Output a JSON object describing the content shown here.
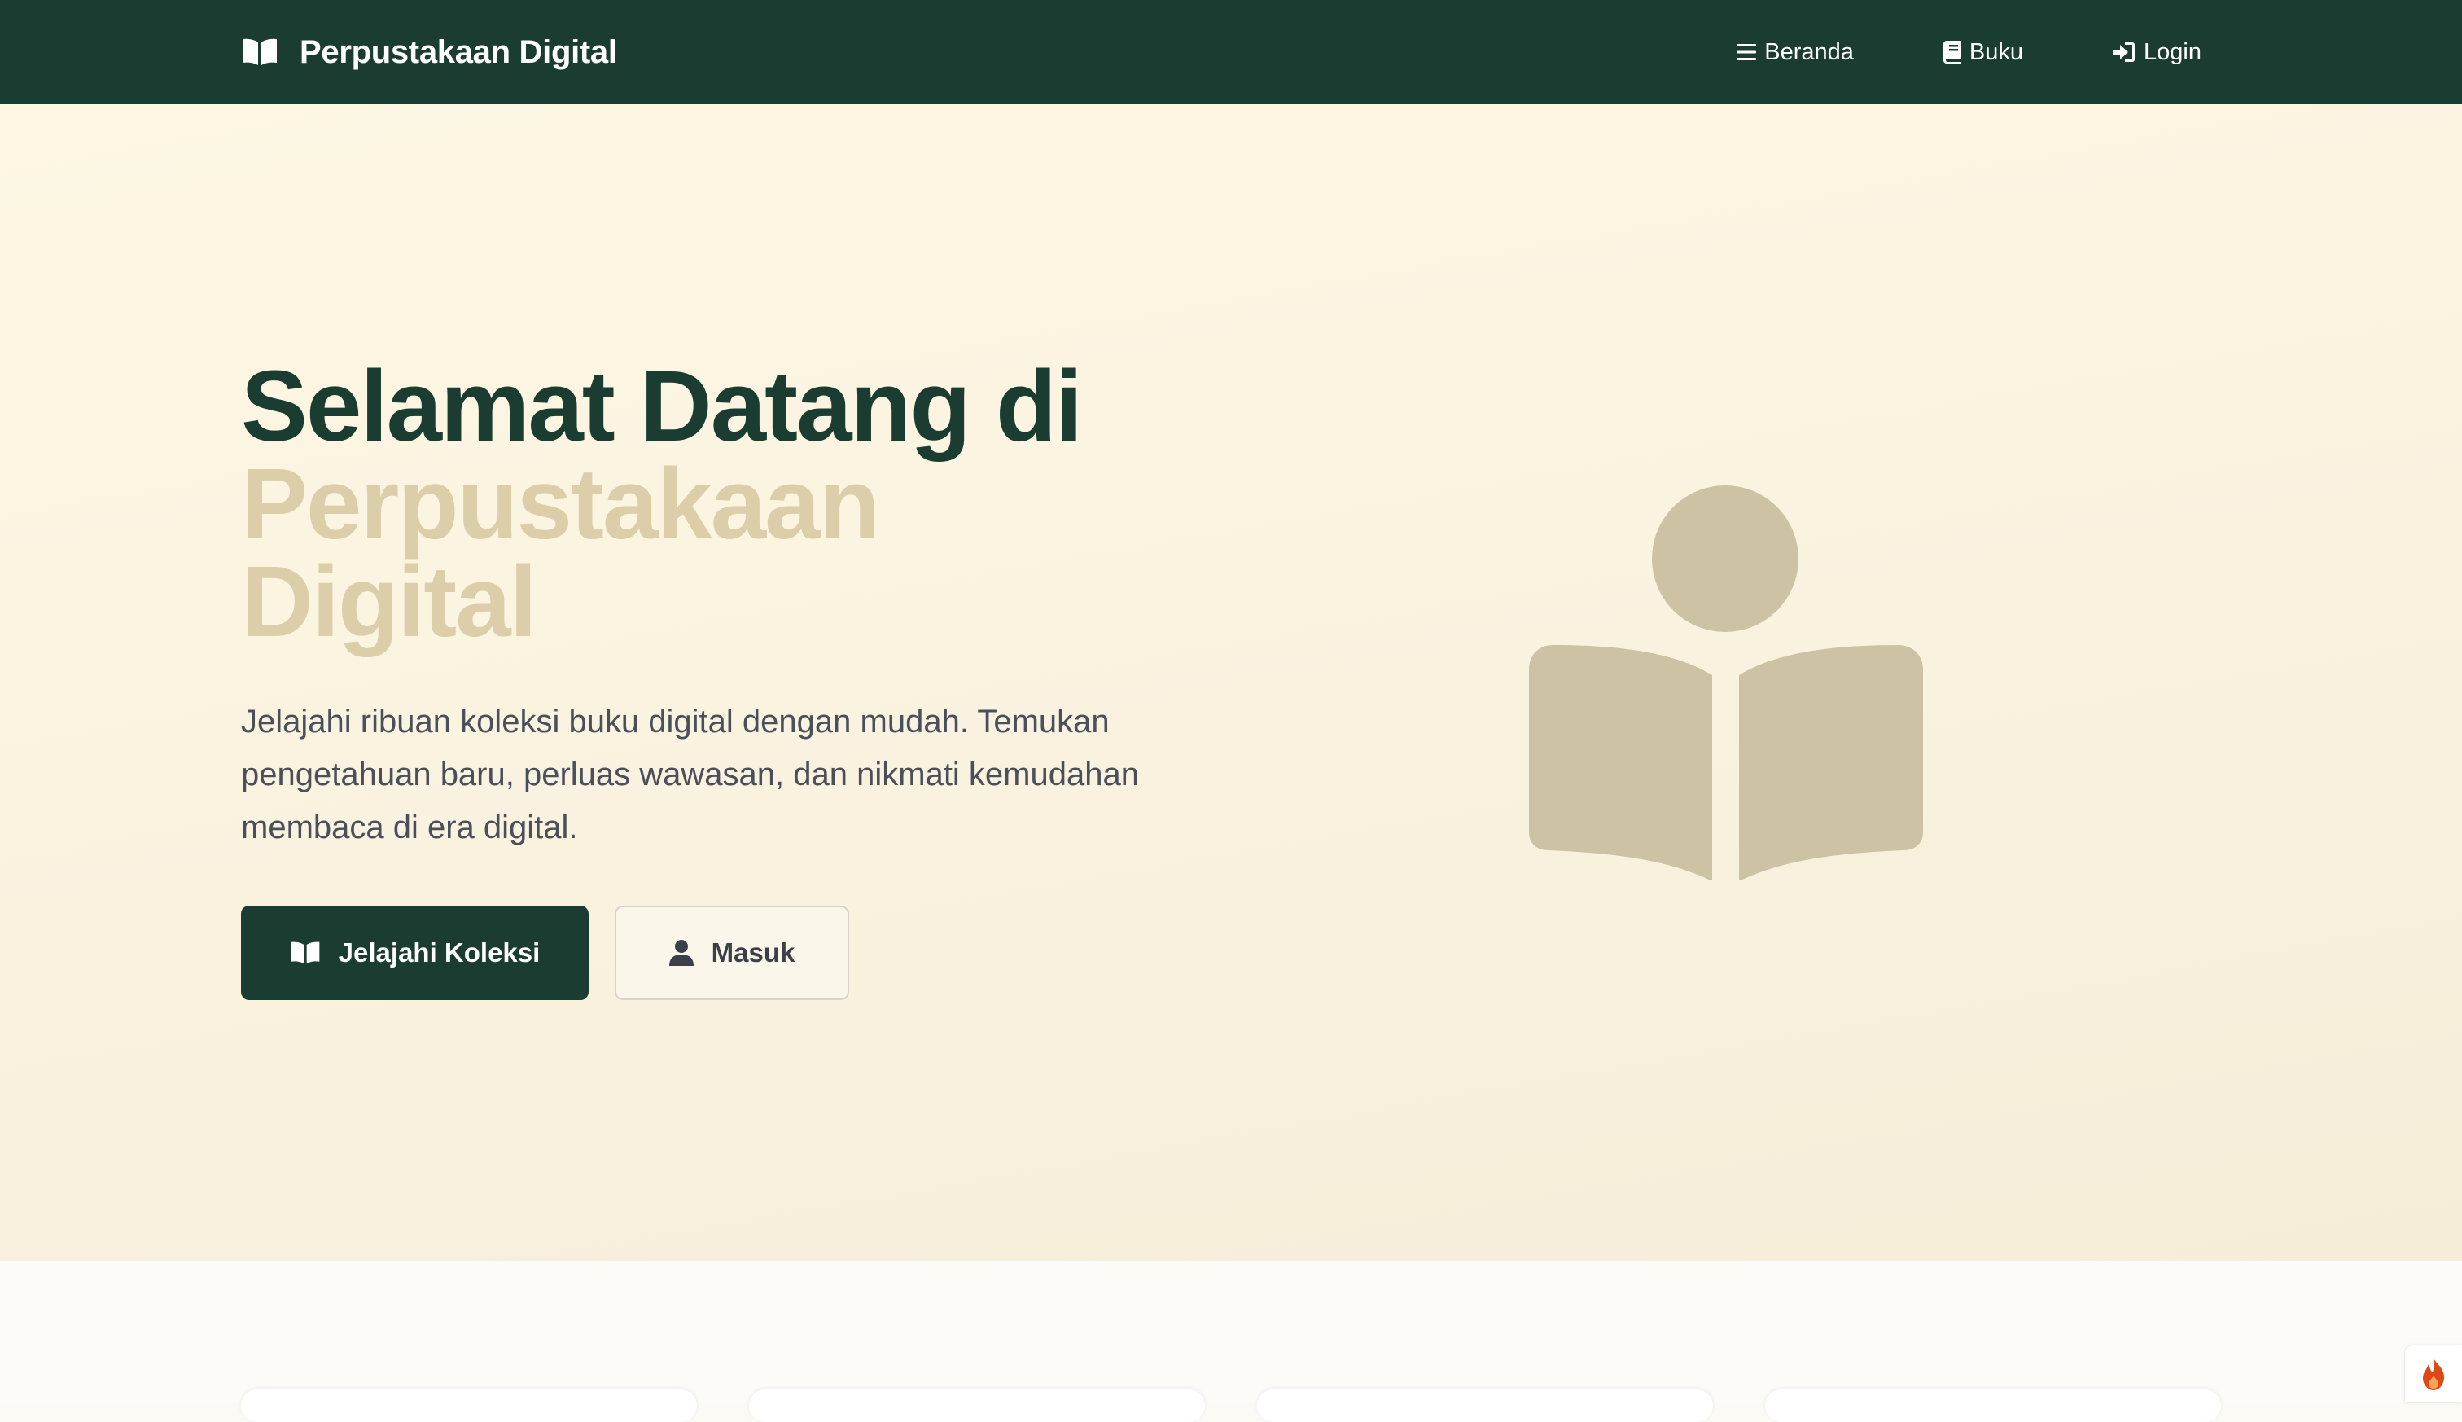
{
  "navbar": {
    "brand": "Perpustakaan Digital",
    "links": [
      {
        "label": "Beranda",
        "icon": "menu-icon"
      },
      {
        "label": "Buku",
        "icon": "book-icon"
      },
      {
        "label": "Login",
        "icon": "login-icon"
      }
    ]
  },
  "hero": {
    "title_line1": "Selamat Datang di",
    "title_accent": "Perpustakaan Digital",
    "description": "Jelajahi ribuan koleksi buku digital dengan mudah. Temukan pengetahuan baru, perluas wawasan, dan nikmati kemudahan membaca di era digital.",
    "primary_button": "Jelajahi Koleksi",
    "secondary_button": "Masuk",
    "illustration_icon": "book-reader-icon"
  },
  "colors": {
    "navbar_bg": "#1b3d31",
    "primary": "#1b3d31",
    "accent_text": "#dbcea9",
    "illustration": "#cdc3a4",
    "hero_bg": "#fdf7e4"
  },
  "floating_widget": {
    "icon": "flame-icon"
  }
}
